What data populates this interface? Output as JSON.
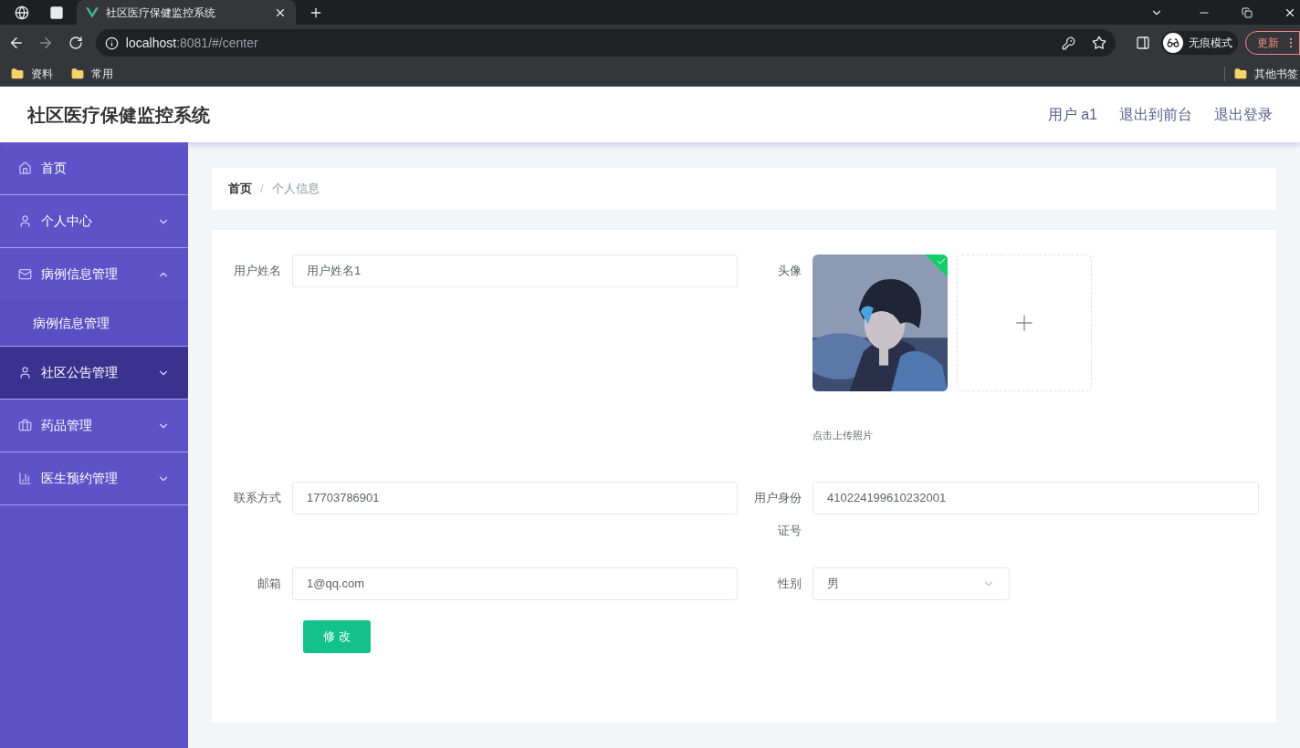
{
  "browser": {
    "tabs": [
      {
        "title": "社区医疗保健监控系统",
        "selected": true
      }
    ],
    "address": {
      "host": "localhost",
      "rest": ":8081/#/center"
    },
    "profile": "无痕模式",
    "update_button": "更新",
    "bookmarks": [
      "资料",
      "常用"
    ],
    "other_bookmarks": "其他书签"
  },
  "header": {
    "title": "社区医疗保健监控系统",
    "links": [
      "用户 a1",
      "退出到前台",
      "退出登录"
    ]
  },
  "sidebar": {
    "items": [
      {
        "label": "首页",
        "kind": "home",
        "selected": false
      },
      {
        "label": "个人中心",
        "kind": "user",
        "selected": false,
        "expanded": false
      },
      {
        "label": "病例信息管理",
        "kind": "mail",
        "selected": false,
        "expanded": true,
        "children": [
          {
            "label": "病例信息管理"
          }
        ]
      },
      {
        "label": "社区公告管理",
        "kind": "user",
        "selected": true,
        "expanded": false
      },
      {
        "label": "药品管理",
        "kind": "box",
        "selected": false,
        "expanded": false
      },
      {
        "label": "医生预约管理",
        "kind": "chart",
        "selected": false,
        "expanded": false
      }
    ]
  },
  "breadcrumb": {
    "separator": "/",
    "items": [
      "首页",
      "个人信息"
    ]
  },
  "form": {
    "rows": [
      [
        {
          "kind": "text",
          "label": "用户姓名",
          "value": "用户姓名1"
        },
        {
          "kind": "upload",
          "label": "头像",
          "hint": "点击上传照片",
          "uploaded": true
        }
      ],
      [
        {
          "kind": "text",
          "label": "联系方式",
          "value": "17703786901"
        },
        {
          "kind": "text",
          "label": "用户身份证号",
          "value": "410224199610232001"
        }
      ],
      [
        {
          "kind": "text",
          "label": "邮箱",
          "value": "1@qq.com"
        },
        {
          "kind": "select",
          "label": "性别",
          "value": "男"
        }
      ]
    ],
    "submit": "修 改"
  }
}
